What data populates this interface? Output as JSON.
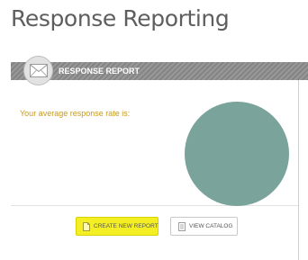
{
  "page": {
    "title": "Response Reporting"
  },
  "panel": {
    "header_label": "RESPONSE REPORT",
    "header_icon": "envelope-icon"
  },
  "report": {
    "rate_label": "Your average response rate is:",
    "rate_circle_color": "#7aa39c"
  },
  "actions": {
    "create_label": "CREATE NEW REPORT",
    "create_icon": "document-icon",
    "create_color": "#f4ee25",
    "catalog_label": "VIEW CATALOG",
    "catalog_icon": "catalog-icon"
  }
}
